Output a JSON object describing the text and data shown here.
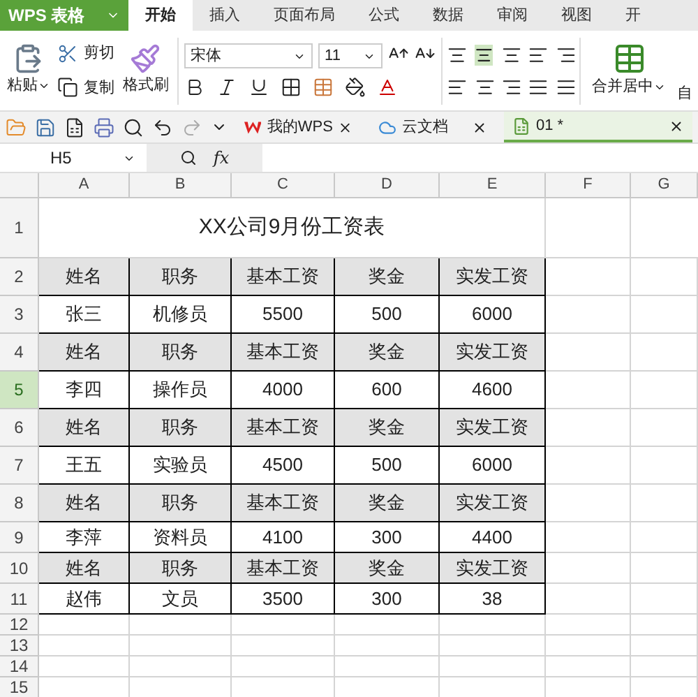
{
  "app_button": {
    "label": "WPS 表格"
  },
  "tabs": [
    {
      "label": "开始",
      "selected": true
    },
    {
      "label": "插入",
      "selected": false
    },
    {
      "label": "页面布局",
      "selected": false
    },
    {
      "label": "公式",
      "selected": false
    },
    {
      "label": "数据",
      "selected": false
    },
    {
      "label": "审阅",
      "selected": false
    },
    {
      "label": "视图",
      "selected": false
    },
    {
      "label": "开",
      "selected": false
    }
  ],
  "ribbon": {
    "paste": "粘贴",
    "cut": "剪切",
    "copy": "复制",
    "format_painter": "格式刷",
    "font_name": "宋体",
    "font_size": "11",
    "merge_center": "合并居中",
    "cut_off_button": "自"
  },
  "doc_tabs": [
    {
      "label": "我的WPS",
      "kind": "wps",
      "selected": false
    },
    {
      "label": "云文档",
      "kind": "cloud",
      "selected": false
    },
    {
      "label": "01 *",
      "kind": "sheet",
      "selected": true
    }
  ],
  "name_box": "H5",
  "formula_label": "fx",
  "columns": [
    "A",
    "B",
    "C",
    "D",
    "E",
    "F",
    "G"
  ],
  "rows": [
    {
      "number": "1",
      "kind": "title",
      "selected": false,
      "cells": [
        "XX公司9月份工资表"
      ]
    },
    {
      "number": "2",
      "kind": "header",
      "selected": false,
      "cells": [
        "姓名",
        "职务",
        "基本工资",
        "奖金",
        "实发工资"
      ]
    },
    {
      "number": "3",
      "kind": "data",
      "selected": false,
      "cells": [
        "张三",
        "机修员",
        "5500",
        "500",
        "6000"
      ]
    },
    {
      "number": "4",
      "kind": "header",
      "selected": false,
      "cells": [
        "姓名",
        "职务",
        "基本工资",
        "奖金",
        "实发工资"
      ]
    },
    {
      "number": "5",
      "kind": "data",
      "selected": true,
      "cells": [
        "李四",
        "操作员",
        "4000",
        "600",
        "4600"
      ]
    },
    {
      "number": "6",
      "kind": "header",
      "selected": false,
      "cells": [
        "姓名",
        "职务",
        "基本工资",
        "奖金",
        "实发工资"
      ]
    },
    {
      "number": "7",
      "kind": "data",
      "selected": false,
      "cells": [
        "王五",
        "实验员",
        "4500",
        "500",
        "6000"
      ]
    },
    {
      "number": "8",
      "kind": "header",
      "selected": false,
      "cells": [
        "姓名",
        "职务",
        "基本工资",
        "奖金",
        "实发工资"
      ]
    },
    {
      "number": "9",
      "kind": "data",
      "selected": false,
      "cells": [
        "李萍",
        "资料员",
        "4100",
        "300",
        "4400"
      ]
    },
    {
      "number": "10",
      "kind": "header",
      "selected": false,
      "cells": [
        "姓名",
        "职务",
        "基本工资",
        "奖金",
        "实发工资"
      ]
    },
    {
      "number": "11",
      "kind": "data",
      "selected": false,
      "cells": [
        "赵伟",
        "文员",
        "3500",
        "300",
        "38"
      ]
    },
    {
      "number": "12",
      "kind": "empty",
      "selected": false,
      "cells": []
    },
    {
      "number": "13",
      "kind": "empty",
      "selected": false,
      "cells": []
    },
    {
      "number": "14",
      "kind": "empty",
      "selected": false,
      "cells": []
    },
    {
      "number": "15",
      "kind": "empty",
      "selected": false,
      "cells": []
    }
  ]
}
